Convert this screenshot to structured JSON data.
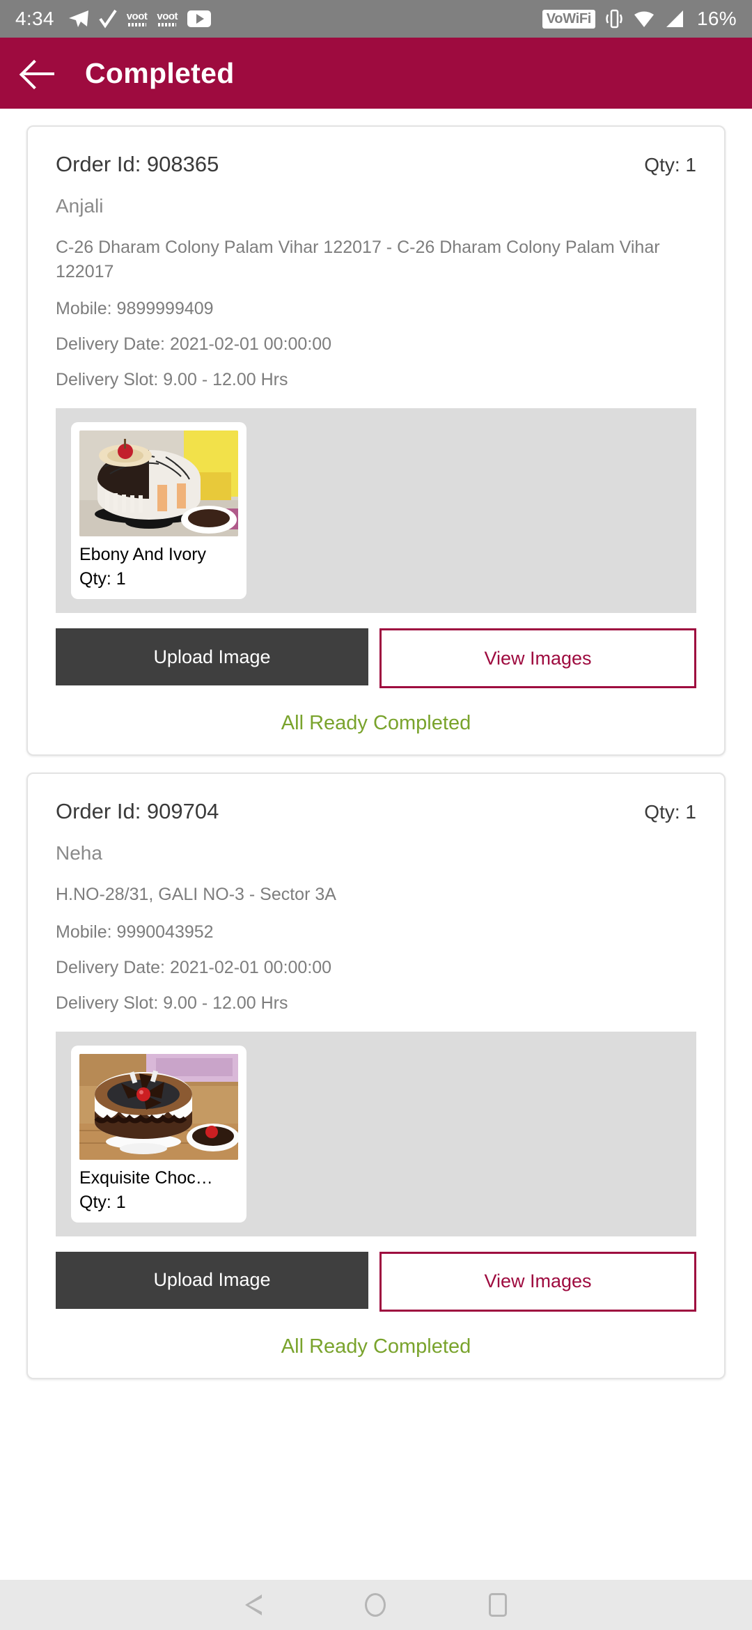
{
  "statusbar": {
    "time": "4:34",
    "icons_left": [
      "telegram-icon",
      "checkmark-icon",
      "voot-icon",
      "voot-icon",
      "youtube-icon"
    ],
    "vowifi_label": "VoWiFi",
    "icons_right": [
      "vibrate-icon",
      "wifi-icon",
      "signal-icon"
    ],
    "battery": "16%"
  },
  "appbar": {
    "back_icon": "back-arrow-icon",
    "title": "Completed",
    "color": "#9e0b3f"
  },
  "colors": {
    "accent": "#9e0b3f",
    "upload_button": "#3f3f3f",
    "status_green": "#79a32c",
    "strip_gray": "#dcdcdc"
  },
  "orders": [
    {
      "order_id_label": "Order Id: 908365",
      "qty_label": "Qty:  1",
      "customer": "Anjali",
      "address": "C-26 Dharam Colony Palam Vihar 122017 - C-26 Dharam Colony Palam Vihar 122017",
      "mobile": "Mobile: 9899999409",
      "delivery_date": "Delivery Date: 2021-02-01 00:00:00",
      "delivery_slot": "Delivery Slot: 9.00 - 12.00 Hrs",
      "item_name": "Ebony And Ivory",
      "item_qty": "Qty: 1",
      "item_thumb": "ebony-and-ivory-cake-image",
      "upload_label": "Upload Image",
      "view_label": "View Images",
      "status": "All Ready Completed"
    },
    {
      "order_id_label": "Order Id: 909704",
      "qty_label": "Qty:  1",
      "customer": "Neha",
      "address": "H.NO-28/31, GALI NO-3 - Sector 3A",
      "mobile": "Mobile: 9990043952",
      "delivery_date": "Delivery Date: 2021-02-01 00:00:00",
      "delivery_slot": "Delivery Slot: 9.00 - 12.00 Hrs",
      "item_name": "Exquisite Choc…",
      "item_qty": "Qty: 1",
      "item_thumb": "exquisite-chocolate-cake-image",
      "upload_label": "Upload Image",
      "view_label": "View Images",
      "status": "All Ready Completed"
    }
  ],
  "navbar": {
    "back": "nav-back-icon",
    "home": "nav-home-icon",
    "recent": "nav-recent-icon"
  }
}
